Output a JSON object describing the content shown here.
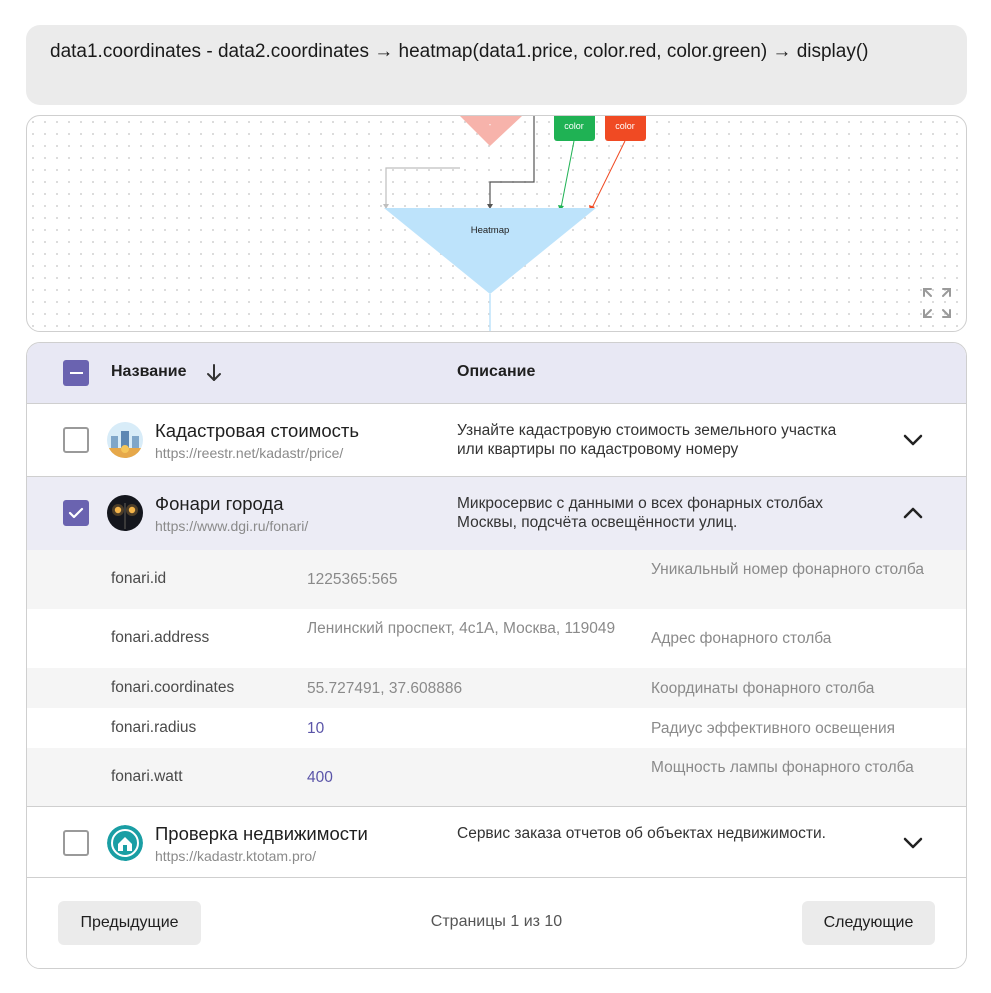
{
  "query": {
    "text": "data1.coordinates - data2.coordinates → heatmap(data1.price, color.red, color.green) → display()"
  },
  "diagram": {
    "nodes": {
      "minus": "-",
      "color_green": "color",
      "color_red": "color",
      "heatmap": "Heatmap"
    },
    "colors": {
      "minus_node": "#f7b3ab",
      "green_node": "#1fb254",
      "red_node": "#f04a23",
      "heatmap_node": "#bde3fb"
    }
  },
  "table": {
    "header": {
      "name": "Название",
      "description": "Описание"
    },
    "rows": [
      {
        "title": "Кадастровая стоимость",
        "url": "https://reestr.net/kadastr/price/",
        "description": "Узнайте кадастровую стоимость земельного участка или квартиры по кадастровому номеру",
        "checked": false,
        "expanded": false
      },
      {
        "title": "Фонари города",
        "url": "https://www.dgi.ru/fonari/",
        "description": "Микросервис с данными о всех фонарных столбах Москвы, подсчёта освещённости улиц.",
        "checked": true,
        "expanded": true,
        "details": [
          {
            "key": "fonari.id",
            "value": "1225365:565",
            "description": "Уникальный номер фонарного столба"
          },
          {
            "key": "fonari.address",
            "value": "Ленинский проспект, 4с1А, Москва, 119049",
            "description": "Адрес фонарного столба"
          },
          {
            "key": "fonari.coordinates",
            "value": "55.727491, 37.608886",
            "description": "Координаты фонарного столба"
          },
          {
            "key": "fonari.radius",
            "value": "10",
            "description": "Радиус эффективного освещения"
          },
          {
            "key": "fonari.watt",
            "value": "400",
            "description": "Мощность лампы фонарного столба"
          }
        ]
      },
      {
        "title": "Проверка недвижимости",
        "url": "https://kadastr.ktotam.pro/",
        "description": "Сервис заказа отчетов об объектах недвижимости.",
        "checked": false,
        "expanded": false
      }
    ]
  },
  "pagination": {
    "prev_label": "Предыдущие",
    "next_label": "Следующие",
    "page_info": "Страницы 1 из 10"
  },
  "accent_color": "#6a63b0"
}
